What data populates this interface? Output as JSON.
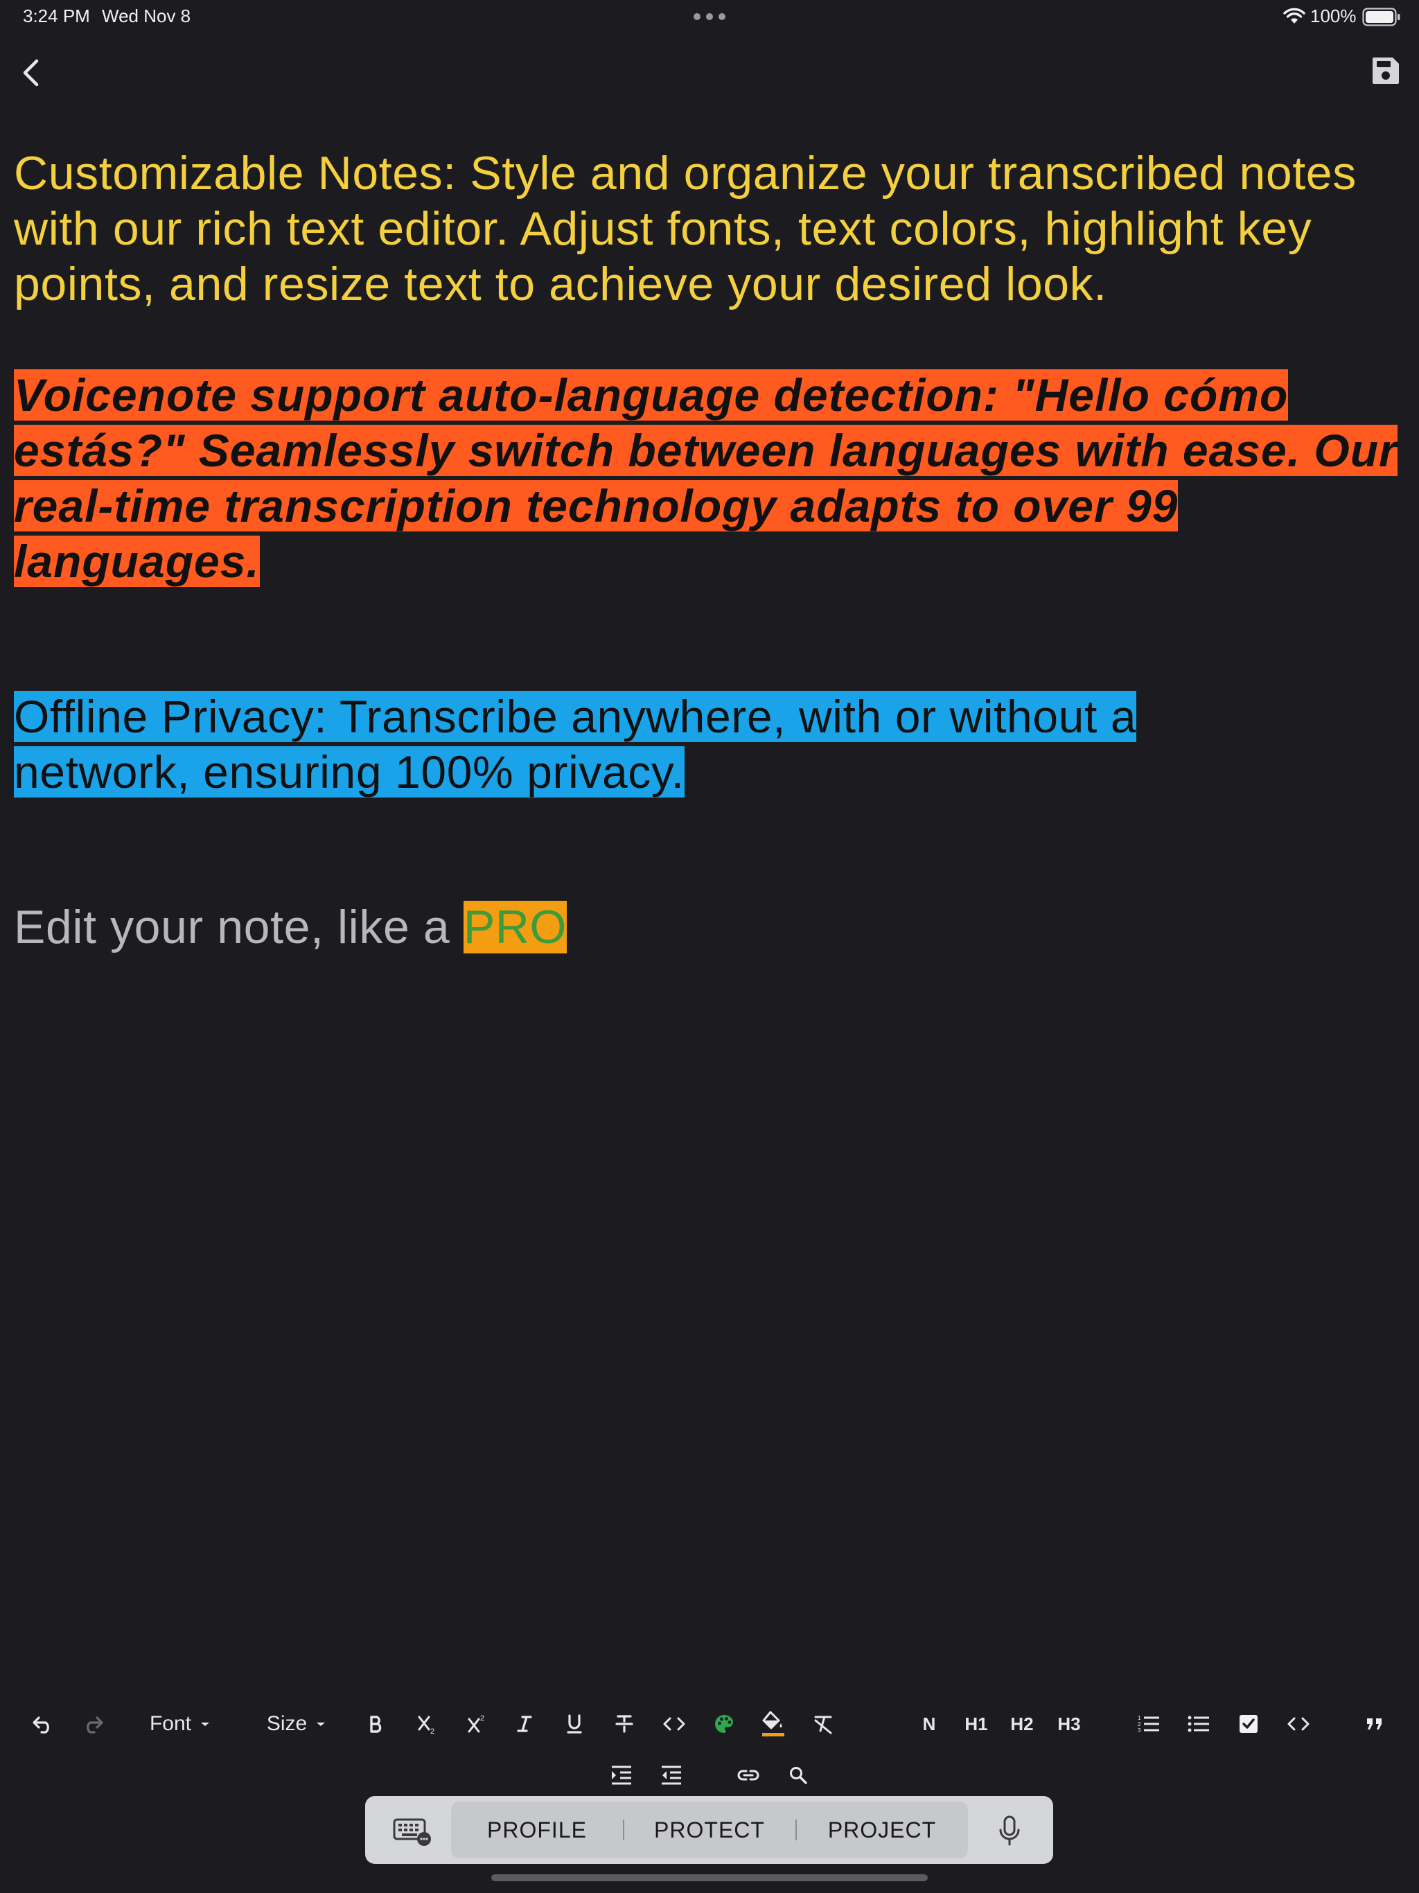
{
  "status_bar": {
    "time": "3:24 PM",
    "date": "Wed Nov 8",
    "battery": "100%"
  },
  "nav": {
    "back_icon": "chevron-left-icon",
    "save_icon": "floppy-disk-icon"
  },
  "note": {
    "para1": "Customizable Notes: Style and organize your transcribed notes with our rich text editor. Adjust fonts, text colors, highlight key points, and resize text to achieve your desired look.",
    "para2": "Voicenote support  auto-language detection: \"Hello cómo estás?\" Seamlessly switch between languages with ease. Our real-time transcription technology adapts to over 99 languages.",
    "para3": "Offline Privacy: Transcribe anywhere, with or without a network, ensuring 100% privacy.",
    "para4_prefix": "Edit your note, like a ",
    "para4_highlight": "PRO"
  },
  "colors": {
    "background": "#1c1c20",
    "para1_text": "#f4d03f",
    "para2_highlight": "#ff5a1f",
    "para3_highlight": "#1aa3e8",
    "pro_highlight": "#f29d12",
    "pro_text": "#3c9c3c"
  },
  "toolbar": {
    "font_label": "Font",
    "size_label": "Size",
    "normal_label": "N",
    "h1_label": "H1",
    "h2_label": "H2",
    "h3_label": "H3",
    "icons": [
      "undo-icon",
      "redo-icon",
      "bold-icon",
      "subscript-icon",
      "superscript-icon",
      "italic-icon",
      "underline-icon",
      "strikethrough-icon",
      "code-icon",
      "palette-icon",
      "fill-color-icon",
      "clear-format-icon",
      "ordered-list-icon",
      "bullet-list-icon",
      "checklist-icon",
      "code-block-icon",
      "quote-icon",
      "indent-icon",
      "outdent-icon",
      "link-icon",
      "search-icon"
    ]
  },
  "keyboard_bar": {
    "suggestions": [
      "PROFILE",
      "PROTECT",
      "PROJECT"
    ],
    "left_icon": "keyboard-icon",
    "right_icon": "microphone-icon"
  }
}
